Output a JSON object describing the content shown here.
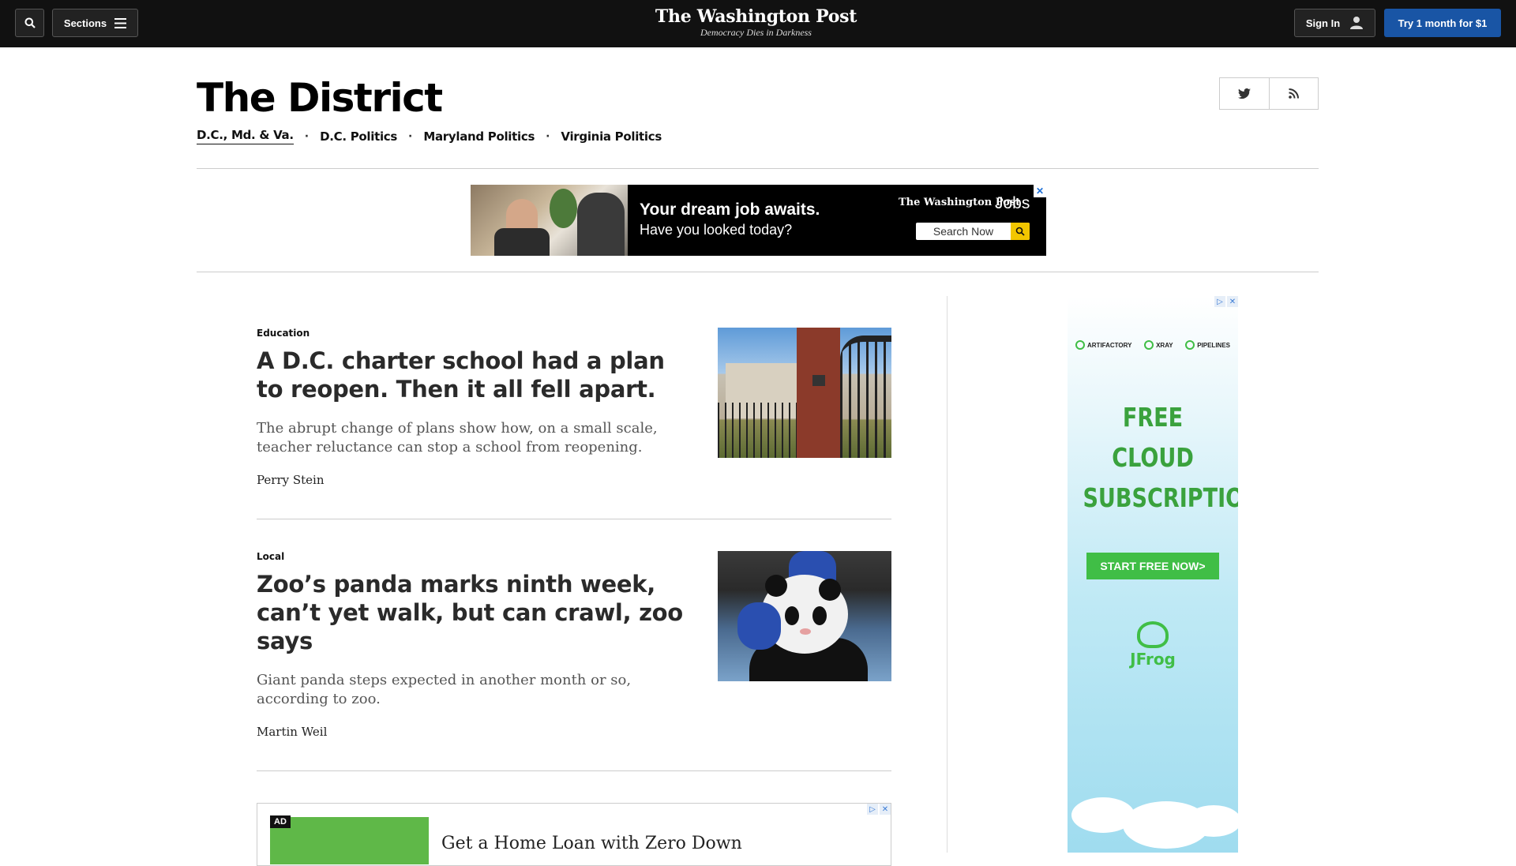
{
  "topbar": {
    "sections_label": "Sections",
    "brand": "The Washington Post",
    "tagline": "Democracy Dies in Darkness",
    "signin_label": "Sign In",
    "subscribe_label": "Try 1 month for $1"
  },
  "section": {
    "title": "The District",
    "nav": [
      {
        "label": "D.C., Md. & Va."
      },
      {
        "label": "D.C. Politics"
      },
      {
        "label": "Maryland Politics"
      },
      {
        "label": "Virginia Politics"
      }
    ]
  },
  "jobs_ad": {
    "headline": "Your dream job awaits.",
    "subhead": "Have you looked today?",
    "brand": "The Washington Post",
    "brand_suffix": "Jobs",
    "search_label": "Search Now",
    "close": "✕"
  },
  "articles": [
    {
      "kicker": "Education",
      "headline": "A D.C. charter school had a plan to reopen. Then it all fell apart.",
      "blurb": "The abrupt change of plans show how, on a small scale, teacher reluctance can stop a school from reopening.",
      "byline": "Perry Stein"
    },
    {
      "kicker": "Local",
      "headline": "Zoo’s panda marks ninth week, can’t yet walk, but can crawl, zoo says",
      "blurb": "Giant panda steps expected in another month or so, according to zoo.",
      "byline": "Martin Weil"
    }
  ],
  "loan_ad": {
    "badge": "AD",
    "headline": "Get a Home Loan with Zero Down"
  },
  "rail_ad": {
    "products": [
      "ARTIFACTORY",
      "XRAY",
      "PIPELINES"
    ],
    "headline_lines": [
      "FREE",
      "CLOUD",
      "SUBSCRIPTION"
    ],
    "cta": "START FREE NOW>",
    "brand": "JFrog"
  },
  "colors": {
    "topbar_bg": "#111111",
    "subscribe_bg": "#1955a5",
    "ad_green": "#40be46"
  }
}
